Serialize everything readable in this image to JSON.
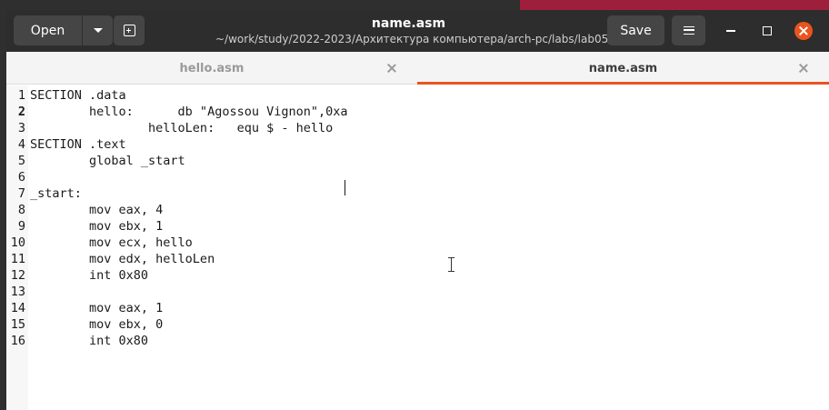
{
  "header": {
    "open_label": "Open",
    "save_label": "Save",
    "title": "name.asm",
    "subtitle": "~/work/study/2022-2023/Архитектура компьютера/arch-pc/labs/lab05"
  },
  "tabs": [
    {
      "label": "hello.asm",
      "active": false
    },
    {
      "label": "name.asm",
      "active": true
    }
  ],
  "editor": {
    "current_line": 2,
    "lines": [
      {
        "num": "1",
        "text": "SECTION .data"
      },
      {
        "num": "2",
        "text": "        hello:      db \"Agossou Vignon\",0xa"
      },
      {
        "num": "3",
        "text": "                helloLen:   equ $ - hello"
      },
      {
        "num": "4",
        "text": "SECTION .text"
      },
      {
        "num": "5",
        "text": "        global _start"
      },
      {
        "num": "6",
        "text": ""
      },
      {
        "num": "7",
        "text": "_start:"
      },
      {
        "num": "8",
        "text": "        mov eax, 4"
      },
      {
        "num": "9",
        "text": "        mov ebx, 1"
      },
      {
        "num": "10",
        "text": "        mov ecx, hello"
      },
      {
        "num": "11",
        "text": "        mov edx, helloLen"
      },
      {
        "num": "12",
        "text": "        int 0x80"
      },
      {
        "num": "13",
        "text": ""
      },
      {
        "num": "14",
        "text": "        mov eax, 1"
      },
      {
        "num": "15",
        "text": "        mov ebx, 0"
      },
      {
        "num": "16",
        "text": "        int 0x80"
      }
    ]
  },
  "colors": {
    "accent": "#e95420",
    "headerbar": "#2d2d2d"
  }
}
